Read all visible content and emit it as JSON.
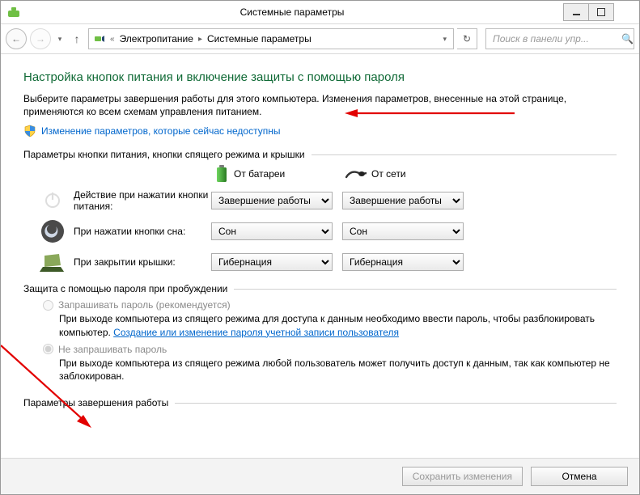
{
  "window": {
    "title": "Системные параметры"
  },
  "breadcrumb": {
    "item1": "Электропитание",
    "item2": "Системные параметры"
  },
  "search": {
    "placeholder": "Поиск в панели упр..."
  },
  "heading": "Настройка кнопок питания и включение защиты с помощью пароля",
  "intro": "Выберите параметры завершения работы для этого компьютера. Изменения параметров, внесенные на этой странице, применяются ко всем схемам управления питанием.",
  "uac_link": "Изменение параметров, которые сейчас недоступны",
  "section1_title": "Параметры кнопки питания, кнопки спящего режима и крышки",
  "cols": {
    "battery": "От батареи",
    "ac": "От сети"
  },
  "rows": {
    "power": {
      "label": "Действие при нажатии кнопки питания:",
      "battery": "Завершение работы",
      "ac": "Завершение работы"
    },
    "sleep": {
      "label": "При нажатии кнопки сна:",
      "battery": "Сон",
      "ac": "Сон"
    },
    "lid": {
      "label": "При закрытии крышки:",
      "battery": "Гибернация",
      "ac": "Гибернация"
    }
  },
  "section2_title": "Защита с помощью пароля при пробуждении",
  "opt1": {
    "label": "Запрашивать пароль (рекомендуется)",
    "desc_a": "При выходе компьютера из спящего режима для доступа к данным необходимо ввести пароль, чтобы разблокировать компьютер. ",
    "link": "Создание или изменение пароля учетной записи пользователя"
  },
  "opt2": {
    "label": "Не запрашивать пароль",
    "desc": "При выходе компьютера из спящего режима любой пользователь может получить доступ к данным, так как компьютер не заблокирован."
  },
  "section3_title": "Параметры завершения работы",
  "footer": {
    "save": "Сохранить изменения",
    "cancel": "Отмена"
  }
}
